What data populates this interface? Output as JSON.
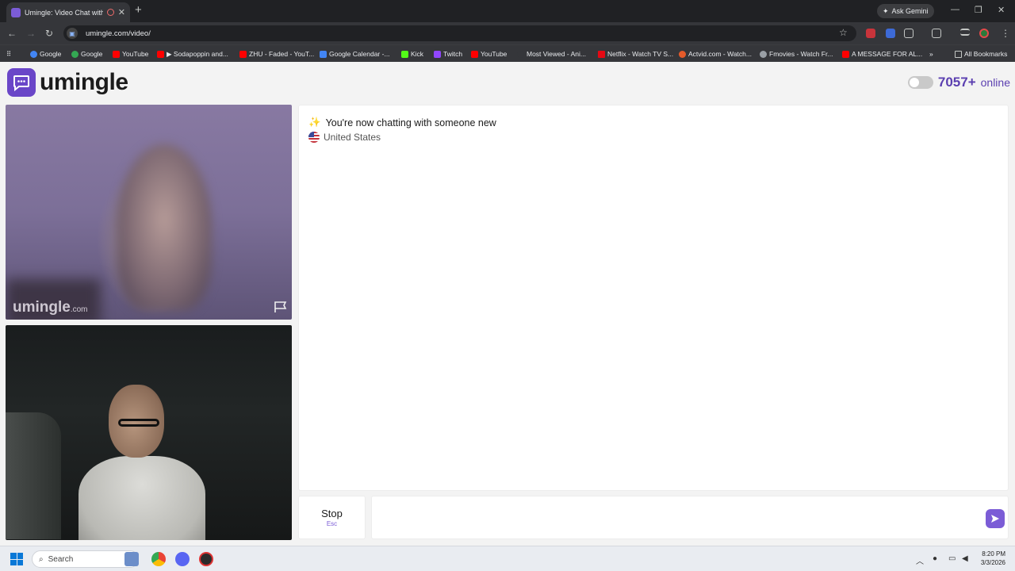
{
  "browser": {
    "tab_title": "Umingle: Video Chat with S",
    "url": "umingle.com/video/",
    "gemini_label": "Ask Gemini",
    "bookmarks": [
      {
        "label": "Google",
        "color": "#4285f4"
      },
      {
        "label": "Google",
        "color": "#34a853"
      },
      {
        "label": "YouTube",
        "color": "#ff0000"
      },
      {
        "label": "▶ Sodapoppin and...",
        "color": "#ff0000"
      },
      {
        "label": "ZHU - Faded - YouT...",
        "color": "#ff0000"
      },
      {
        "label": "Google Calendar -...",
        "color": "#4285f4"
      },
      {
        "label": "Kick",
        "color": "#53fc18"
      },
      {
        "label": "Twitch",
        "color": "#9146ff"
      },
      {
        "label": "YouTube",
        "color": "#ff0000"
      },
      {
        "label": "Most Viewed - Ani...",
        "color": "#35363a"
      },
      {
        "label": "Netflix - Watch TV S...",
        "color": "#e50914"
      },
      {
        "label": "Actvid.com - Watch...",
        "color": "#e55b2a"
      },
      {
        "label": "Fmovies - Watch Fr...",
        "color": "#9aa0a6"
      },
      {
        "label": "A MESSAGE FOR AL...",
        "color": "#ff0000"
      }
    ],
    "all_bookmarks": "All Bookmarks"
  },
  "site": {
    "logo_text": "umingle",
    "online_count": "7057+",
    "online_label": "online",
    "brand_color": "#6a46c8"
  },
  "video": {
    "watermark_main": "umingle",
    "watermark_suffix": ".com"
  },
  "chat": {
    "notice_emoji": "✨",
    "notice": "You're now chatting with someone new",
    "country": "United States"
  },
  "controls": {
    "stop_label": "Stop",
    "stop_key": "Esc",
    "message_placeholder": ""
  },
  "taskbar": {
    "search_label": "Search",
    "time": "8:20 PM",
    "date": "3/3/2026"
  }
}
